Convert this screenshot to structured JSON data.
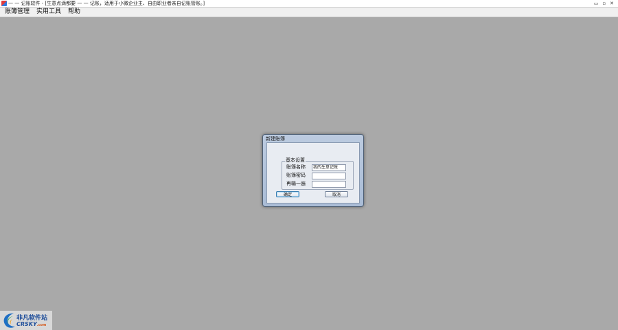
{
  "window": {
    "title": "一 一 记账软件 - [生意点滴都要 一 一 记账，适用于小微企业主、自由职业者亲自记账管账。]",
    "controls": [
      "▭",
      "▫",
      "✕"
    ]
  },
  "menubar": {
    "items": [
      "账簿管理",
      "实用工具",
      "帮助"
    ]
  },
  "dialog": {
    "title": "新建账簿",
    "group_title": "基本设置",
    "fields": [
      {
        "label": "账簿名称",
        "value": "我的生意记账",
        "placeholder": ""
      },
      {
        "label": "账簿密码",
        "value": "",
        "placeholder": ""
      },
      {
        "label": "再输一遍",
        "value": "",
        "placeholder": ""
      }
    ],
    "ok_label": "确定",
    "cancel_label": "取消"
  },
  "watermark": {
    "cn": "非凡软件站",
    "en": "CRSKY",
    "en_suffix": ".com"
  },
  "colors": {
    "workspace": "#a9a9a9",
    "dialog_frame": "#a9bcd6",
    "brand": "#1f4e9a"
  }
}
